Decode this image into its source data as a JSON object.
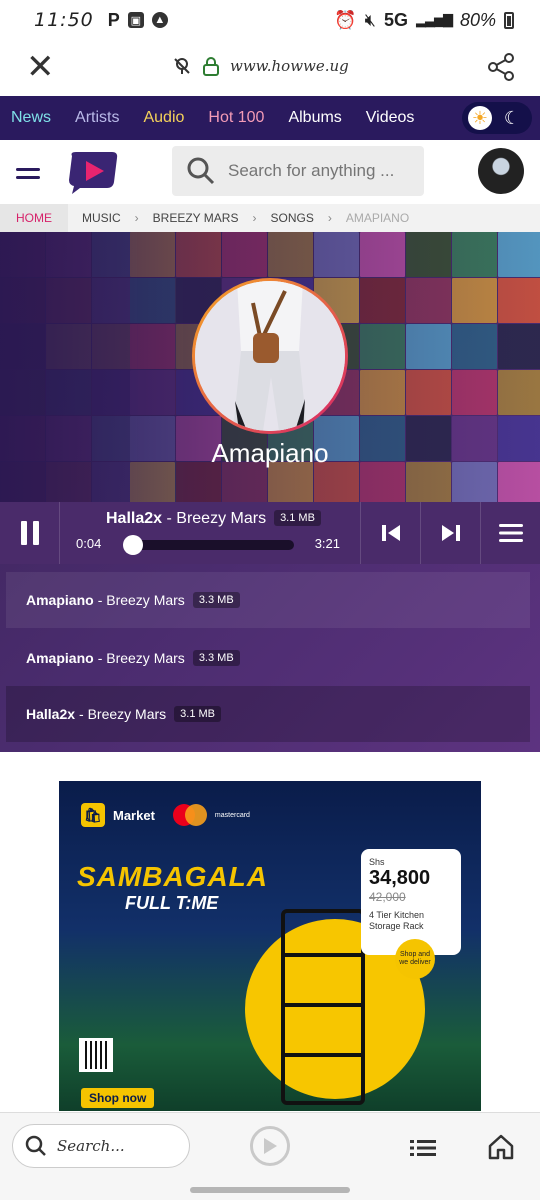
{
  "status_bar": {
    "time": "11:50",
    "network": "5G",
    "battery": "80%"
  },
  "browser": {
    "url": "www.howwe.ug"
  },
  "nav": {
    "items": [
      {
        "label": "News",
        "color": "#7fe0e8"
      },
      {
        "label": "Artists",
        "color": "#b9b9e8"
      },
      {
        "label": "Audio",
        "color": "#f5d25a"
      },
      {
        "label": "Hot 100",
        "color": "#f39bb6"
      },
      {
        "label": "Albums",
        "color": "#ffffff"
      },
      {
        "label": "Videos",
        "color": "#ffffff"
      }
    ]
  },
  "header": {
    "search_placeholder": "Search for anything ..."
  },
  "breadcrumb": {
    "home": "HOME",
    "items": [
      "MUSIC",
      "BREEZY MARS",
      "SONGS"
    ],
    "current": "AMAPIANO"
  },
  "album": {
    "title": "Amapiano"
  },
  "player": {
    "song": "Halla2x",
    "artist": " - Breezy Mars",
    "size": "3.1 MB",
    "elapsed": "0:04",
    "duration": "3:21",
    "progress": 0.02
  },
  "playlist": [
    {
      "title": "Amapiano",
      "artist": "- Breezy Mars",
      "size": "3.3 MB"
    },
    {
      "title": "Amapiano",
      "artist": "- Breezy Mars",
      "size": "3.3 MB"
    },
    {
      "title": "Halla2x",
      "artist": "- Breezy Mars",
      "size": "3.1 MB"
    }
  ],
  "ad": {
    "brand": "Market",
    "card_brand": "mastercard",
    "headline": "SAMBAGALA",
    "subheadline": "FULL T:ME",
    "currency": "Shs",
    "price": "34,800",
    "old_price": "42,000",
    "product": "4 Tier Kitchen Storage Rack",
    "deliver_note": "Shop and we deliver",
    "cta": "Shop now"
  },
  "bottom_bar": {
    "search_label": "Search..."
  },
  "colors": {
    "accent": "#d6226a",
    "nav_bg": "#2a1a5e",
    "hero_bg": "#4a2c6e"
  }
}
